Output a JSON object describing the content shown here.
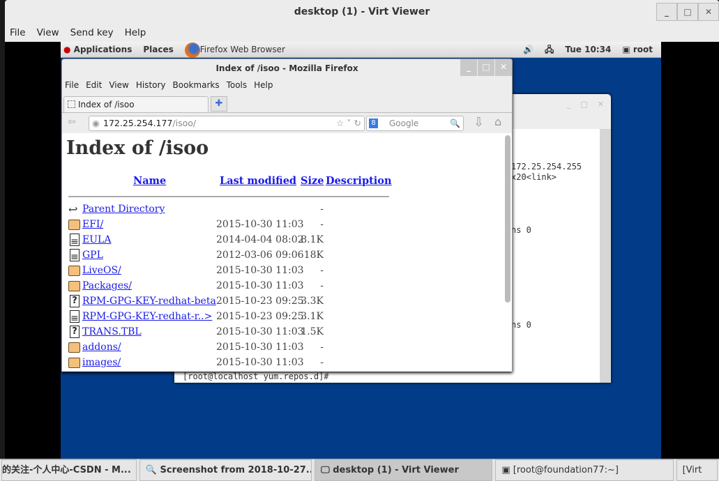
{
  "viewer": {
    "title": "desktop (1) - Virt Viewer",
    "controls": [
      "_",
      "□",
      "✕"
    ],
    "menu": [
      "File",
      "View",
      "Send key",
      "Help"
    ]
  },
  "panel": {
    "applications": "Applications",
    "places": "Places",
    "firefox_label": "Firefox Web Browser",
    "clock": "Tue 10:34",
    "user": "root"
  },
  "terminal": {
    "lines": [
      "172.25.254.255",
      "x20<link>",
      "ns 0",
      "ns 0"
    ],
    "prompt": "[root@localhost yum.repos.d]# "
  },
  "firefox": {
    "title": "Index of /isoo - Mozilla Firefox",
    "menu": [
      "File",
      "Edit",
      "View",
      "History",
      "Bookmarks",
      "Tools",
      "Help"
    ],
    "tab": "Index of /isoo",
    "url_host": "172.25.254.177",
    "url_path": "/isoo/",
    "search_placeholder": "Google"
  },
  "page": {
    "heading": "Index of /isoo",
    "columns": [
      "Name",
      "Last modified",
      "Size",
      "Description"
    ],
    "rows": [
      {
        "icon": "back",
        "name": "Parent Directory",
        "date": "",
        "size": "-"
      },
      {
        "icon": "folder",
        "name": "EFI/",
        "date": "2015-10-30 11:03",
        "size": "-"
      },
      {
        "icon": "file",
        "name": "EULA",
        "date": "2014-04-04 08:02",
        "size": "8.1K"
      },
      {
        "icon": "file",
        "name": "GPL",
        "date": "2012-03-06 09:06",
        "size": "18K"
      },
      {
        "icon": "folder",
        "name": "LiveOS/",
        "date": "2015-10-30 11:03",
        "size": "-"
      },
      {
        "icon": "folder",
        "name": "Packages/",
        "date": "2015-10-30 11:03",
        "size": "-"
      },
      {
        "icon": "unknown",
        "name": "RPM-GPG-KEY-redhat-beta",
        "date": "2015-10-23 09:25",
        "size": "3.3K"
      },
      {
        "icon": "file",
        "name": "RPM-GPG-KEY-redhat-r..>",
        "date": "2015-10-23 09:25",
        "size": "3.1K"
      },
      {
        "icon": "unknown",
        "name": "TRANS.TBL",
        "date": "2015-10-30 11:03",
        "size": "1.5K"
      },
      {
        "icon": "folder",
        "name": "addons/",
        "date": "2015-10-30 11:03",
        "size": "-"
      },
      {
        "icon": "folder",
        "name": "images/",
        "date": "2015-10-30 11:03",
        "size": "-"
      }
    ]
  },
  "taskbar": [
    "的关注-个人中心-CSDN - M...",
    "Screenshot from 2018-10-27...",
    "desktop (1) - Virt Viewer",
    "[root@foundation77:~]",
    "[Virt"
  ],
  "colors": {
    "desktop": "#023c88",
    "link": "#1a1ae6"
  }
}
